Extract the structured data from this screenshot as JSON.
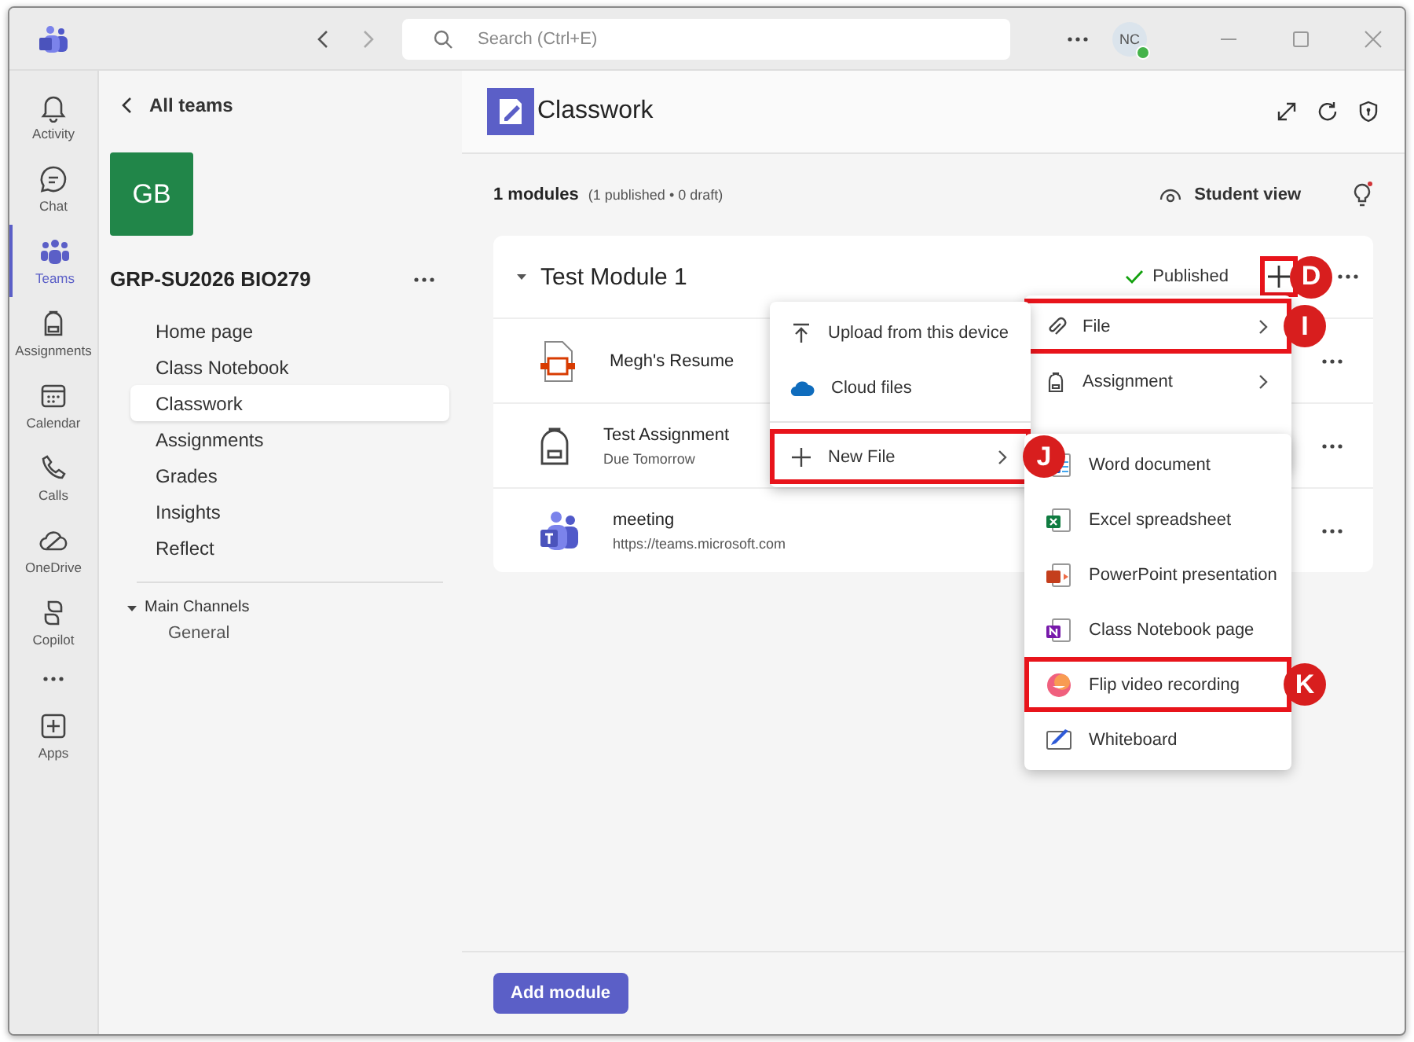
{
  "title_bar": {
    "search": {
      "placeholder": "Search (Ctrl+E)"
    },
    "avatar": {
      "initials": "NC"
    }
  },
  "app_bar": {
    "items": [
      {
        "label": "Activity",
        "selected": false
      },
      {
        "label": "Chat",
        "selected": false
      },
      {
        "label": "Teams",
        "selected": true
      },
      {
        "label": "Assignments",
        "selected": false
      },
      {
        "label": "Calendar",
        "selected": false
      },
      {
        "label": "Calls",
        "selected": false
      },
      {
        "label": "OneDrive",
        "selected": false
      },
      {
        "label": "Copilot",
        "selected": false
      }
    ],
    "apps": {
      "label": "Apps"
    }
  },
  "sidebar": {
    "back_label": "All teams",
    "team_tile": "GB",
    "team_name": "GRP-SU2026 BIO279",
    "nav": [
      {
        "label": "Home page",
        "selected": false
      },
      {
        "label": "Class Notebook",
        "selected": false
      },
      {
        "label": "Classwork",
        "selected": true
      },
      {
        "label": "Assignments",
        "selected": false
      },
      {
        "label": "Grades",
        "selected": false
      },
      {
        "label": "Insights",
        "selected": false
      },
      {
        "label": "Reflect",
        "selected": false
      }
    ],
    "channels": {
      "label": "Main Channels",
      "expanded": true,
      "items": [
        "General"
      ]
    }
  },
  "main": {
    "title": "Classwork",
    "summary": {
      "count": "1 modules",
      "detail": "(1 published • 0 draft)"
    },
    "student_view": "Student view",
    "module": {
      "title": "Test Module 1",
      "expanded": true,
      "status": "Published",
      "add_highlighted": true,
      "add_callout": "D",
      "items": [
        {
          "kind": "file",
          "title": "Megh's Resume"
        },
        {
          "kind": "assignment",
          "title": "Test Assignment",
          "subtitle": "Due Tomorrow"
        },
        {
          "kind": "link",
          "title": "meeting",
          "subtitle": "https://teams.microsoft.com"
        }
      ]
    },
    "add_module": "Add module"
  },
  "add_menu": [
    {
      "label": "File",
      "submenu": true,
      "highlighted": true,
      "callout": "I"
    },
    {
      "label": "Assignment",
      "submenu": true,
      "highlighted": false
    }
  ],
  "file_menu": [
    {
      "label": "Upload from this device",
      "submenu": false,
      "highlighted": false
    },
    {
      "label": "Cloud files",
      "submenu": false,
      "highlighted": false
    },
    {
      "label": "New File",
      "submenu": true,
      "highlighted": true,
      "callout": "J"
    }
  ],
  "new_file_menu": [
    {
      "label": "Word document",
      "highlighted": false
    },
    {
      "label": "Excel spreadsheet",
      "highlighted": false
    },
    {
      "label": "PowerPoint presentation",
      "highlighted": false
    },
    {
      "label": "Class Notebook page",
      "highlighted": false
    },
    {
      "label": "Flip video recording",
      "highlighted": true,
      "callout": "K"
    },
    {
      "label": "Whiteboard",
      "highlighted": false
    }
  ]
}
